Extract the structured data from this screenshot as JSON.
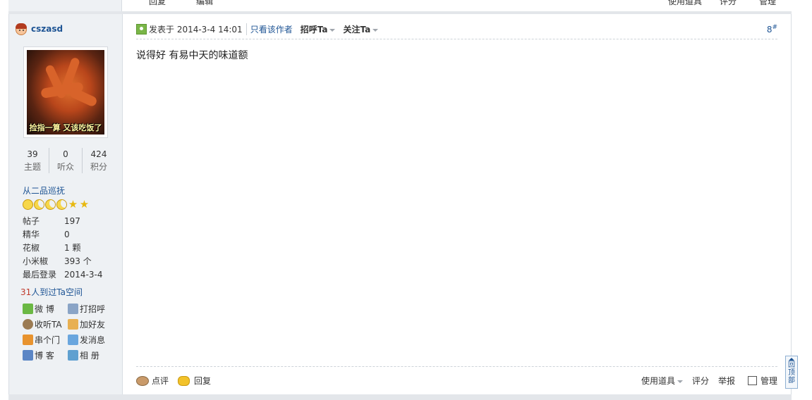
{
  "prev_footer": {
    "reply_label": "回复",
    "edit_label": "编辑",
    "tools_label": "使用道具",
    "rate_label": "评分",
    "manage_label": "管理"
  },
  "author": {
    "name": "cszasd",
    "avatar_caption": "捡指一算 又该吃饭了",
    "stats": [
      {
        "num": "39",
        "label": "主题"
      },
      {
        "num": "0",
        "label": "听众"
      },
      {
        "num": "424",
        "label": "积分"
      }
    ],
    "group": "从二品巡抚",
    "info": [
      {
        "key": "帖子",
        "value": "197"
      },
      {
        "key": "精华",
        "value": "0"
      },
      {
        "key": "花椒",
        "value": "1 颗"
      },
      {
        "key": "小米椒",
        "value": "393 个"
      },
      {
        "key": "最后登录",
        "value": "2014-3-4"
      }
    ],
    "visited_count": "31",
    "visited_text": "人到过Ta空间",
    "actions": {
      "weibo": "微 博",
      "hello": "打招呼",
      "listen": "收听TA",
      "add_friend": "加好友",
      "visit": "串个门",
      "message": "发消息",
      "blog": "博 客",
      "album": "相 册"
    }
  },
  "post": {
    "posted_at": "发表于 2014-3-4 14:01",
    "only_author": "只看该作者",
    "greet": "招呼Ta",
    "follow": "关注Ta",
    "floor": "8",
    "floor_sup": "#",
    "message": "说得好 有易中天的味道额",
    "footer": {
      "comment": "点评",
      "reply": "回复",
      "tools": "使用道具",
      "rate": "评分",
      "report": "举报",
      "manage": "管理"
    }
  },
  "to_top": {
    "chars": [
      "回",
      "顶",
      "部"
    ]
  }
}
